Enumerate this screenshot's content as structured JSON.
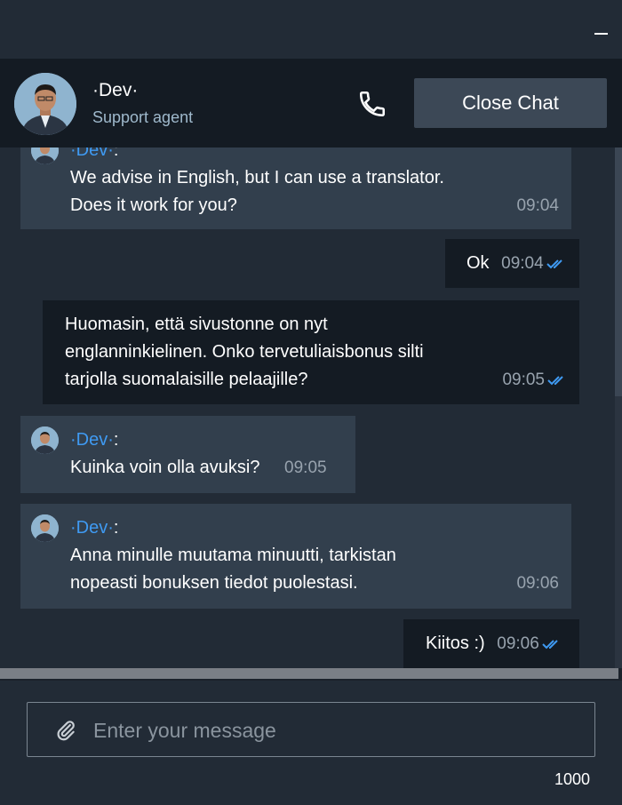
{
  "header": {
    "agent_name": "·Dev·",
    "agent_role": "Support agent",
    "close_label": "Close Chat"
  },
  "messages": [
    {
      "type": "agent",
      "sender": "·Dev·",
      "colon": ":",
      "lines": [
        "We advise in English, but I can use a translator.",
        "Does it work for you?"
      ],
      "time": "09:04"
    },
    {
      "type": "user",
      "text": "Ok",
      "time": "09:04"
    },
    {
      "type": "user",
      "lines": [
        "Huomasin, että sivustonne on nyt",
        "englanninkielinen. Onko tervetuliaisbonus silti",
        "tarjolla suomalaisille pelaajille?"
      ],
      "time": "09:05"
    },
    {
      "type": "agent",
      "sender": "·Dev·",
      "colon": ":",
      "text": "Kuinka voin olla avuksi?",
      "time": "09:05"
    },
    {
      "type": "agent",
      "sender": "·Dev·",
      "colon": ":",
      "lines": [
        "Anna minulle muutama minuutti, tarkistan",
        "nopeasti bonuksen tiedot puolestasi."
      ],
      "time": "09:06"
    },
    {
      "type": "user",
      "text": "Kiitos :)",
      "time": "09:06"
    }
  ],
  "composer": {
    "placeholder": "Enter your message",
    "char_count": "1000"
  },
  "colors": {
    "accent": "#3f9af2",
    "panel_dark": "#141b23",
    "agent_bubble": "#323f4d",
    "background": "#222b36"
  },
  "icons": [
    "minimize-icon",
    "phone-icon",
    "double-check-icon",
    "paperclip-icon"
  ]
}
